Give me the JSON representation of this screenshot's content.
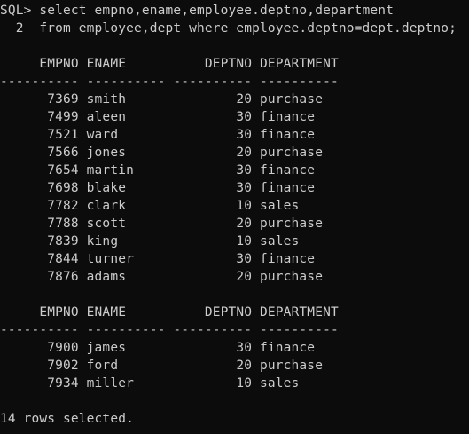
{
  "window": {
    "title": ""
  },
  "terminal": {
    "command_lines": [
      "SQL> select empno,ename,employee.deptno,department",
      "  2  from employee,dept where employee.deptno=dept.deptno;"
    ],
    "result_blocks": [
      {
        "header": "     EMPNO ENAME          DEPTNO DEPARTMENT",
        "separator": "---------- ---------- ---------- ----------",
        "rows": [
          "      7369 smith              20 purchase",
          "      7499 aleen              30 finance",
          "      7521 ward               30 finance",
          "      7566 jones              20 purchase",
          "      7654 martin             30 finance",
          "      7698 blake              30 finance",
          "      7782 clark              10 sales",
          "      7788 scott              20 purchase",
          "      7839 king               10 sales",
          "      7844 turner             30 finance",
          "      7876 adams              20 purchase"
        ]
      },
      {
        "header": "     EMPNO ENAME          DEPTNO DEPARTMENT",
        "separator": "---------- ---------- ---------- ----------",
        "rows": [
          "      7900 james              30 finance",
          "      7902 ford               20 purchase",
          "      7934 miller             10 sales"
        ]
      }
    ],
    "footer": "14 rows selected."
  },
  "colors": {
    "background": "#0c0c0c",
    "text": "#cccccc"
  }
}
